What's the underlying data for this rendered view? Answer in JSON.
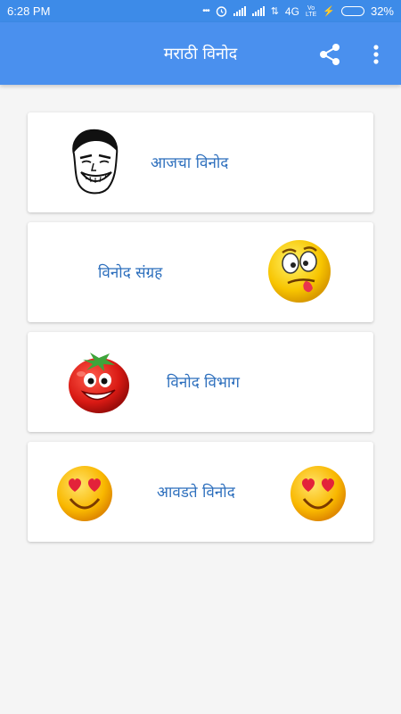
{
  "status_bar": {
    "time": "6:28 PM",
    "dots": "•••",
    "network": "4G",
    "lte_top": "Vo",
    "lte_bottom": "LTE",
    "battery_percent": "32%",
    "battery_level": 0.32
  },
  "app_bar": {
    "title": "मराठी विनोद",
    "share_icon": "share-icon",
    "menu_icon": "more-vertical-icon"
  },
  "menu": {
    "items": [
      {
        "label": "आजचा विनोद",
        "icon": "troll-face-icon"
      },
      {
        "label": "विनोद संग्रह",
        "icon": "silly-emoji-icon"
      },
      {
        "label": "विनोद विभाग",
        "icon": "tomato-face-icon"
      },
      {
        "label": "आवडते विनोद",
        "icon": "heart-eyes-emoji-icon"
      }
    ]
  },
  "colors": {
    "app_bar": "#4a90ee",
    "status_bar": "#3d8be8",
    "label_text": "#2d6fbd",
    "background": "#f5f5f5"
  }
}
